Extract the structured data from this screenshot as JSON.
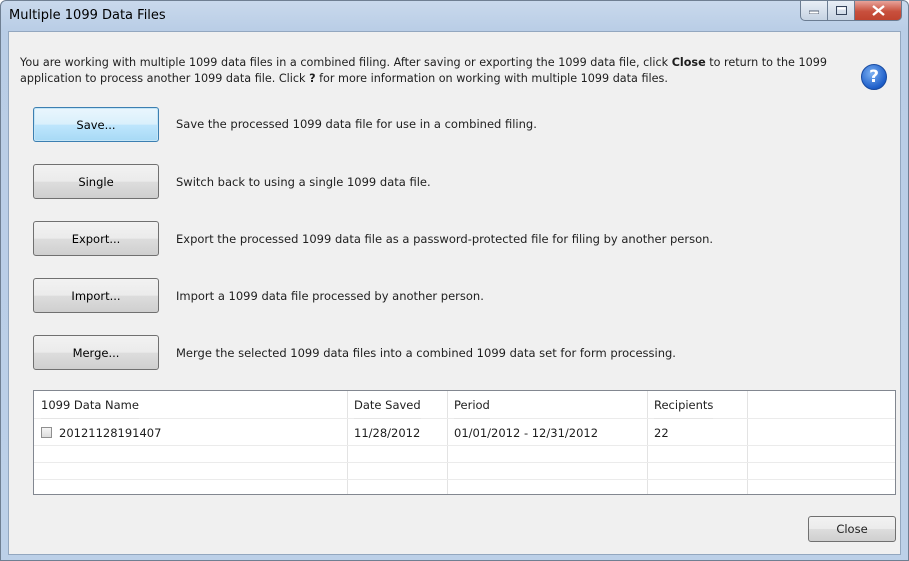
{
  "window": {
    "title": "Multiple 1099 Data Files"
  },
  "intro": {
    "part1": "You are working with multiple 1099 data files in a combined filing. After saving or exporting the 1099 data file, click ",
    "close_word": "Close",
    "part2": " to return to the 1099 application to process another 1099 data file. Click ",
    "q_word": "?",
    "part3": " for more information on working with multiple 1099 data files."
  },
  "help_icon": "question-mark-icon",
  "actions": [
    {
      "label": "Save...",
      "description": "Save the processed 1099 data file for use in a combined filing."
    },
    {
      "label": "Single",
      "description": "Switch back to using a single 1099 data file."
    },
    {
      "label": "Export...",
      "description": "Export the processed 1099 data file as a password-protected file for filing by another person."
    },
    {
      "label": "Import...",
      "description": "Import a 1099 data file processed by another person."
    },
    {
      "label": "Merge...",
      "description": "Merge the selected 1099 data files into a combined 1099 data set for form processing."
    }
  ],
  "table": {
    "columns": [
      "1099 Data Name",
      "Date Saved",
      "Period",
      "Recipients"
    ],
    "rows": [
      {
        "name": "20121128191407",
        "date_saved": "11/28/2012",
        "period": "01/01/2012 - 12/31/2012",
        "recipients": "22",
        "checked": false
      }
    ]
  },
  "footer": {
    "close_label": "Close"
  }
}
